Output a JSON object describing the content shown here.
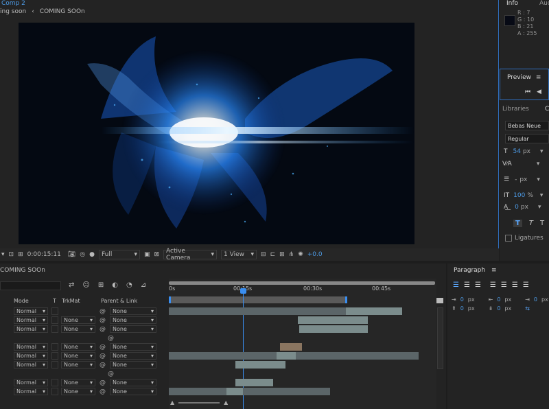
{
  "viewer": {
    "tab_comp": "Comp 2",
    "breadcrumb_1": "ing soon",
    "breadcrumb_sep": "‹",
    "breadcrumb_2": "COMING SOOn",
    "timecode": "0:00:15:11",
    "resolution": "Full",
    "camera": "Active Camera",
    "view": "1 View",
    "exposure": "+0.0"
  },
  "info": {
    "tab_info": "Info",
    "tab_audio": "Aud",
    "r": "R : 7",
    "g": "G : 10",
    "b": "B : 21",
    "a": "A : 255",
    "swatch_color": "#070a15"
  },
  "preview": {
    "title": "Preview",
    "menu": "≡"
  },
  "character": {
    "libraries": "Libraries",
    "font": "Bebas Neue",
    "style": "Regular",
    "size": "54",
    "size_unit": "px",
    "leading_value": "-",
    "leading_unit": "px",
    "vscale": "100",
    "vscale_unit": "%",
    "baseline": "0",
    "baseline_unit": "px",
    "ligatures": "Ligatures"
  },
  "timeline": {
    "comp_name": "COMING SOOn",
    "ruler": [
      "0s",
      "00:15s",
      "00:30s",
      "00:45s"
    ],
    "headers": {
      "mode": "Mode",
      "t": "T",
      "trkmat": "TrkMat",
      "parent": "Parent & Link"
    },
    "rows": [
      {
        "mode": "Normal",
        "trkmat": "",
        "parent": "None"
      },
      {
        "mode": "Normal",
        "trkmat": "None",
        "parent": "None"
      },
      {
        "mode": "Normal",
        "trkmat": "None",
        "parent": "None"
      },
      {
        "mode": "",
        "trkmat": "",
        "parent": ""
      },
      {
        "mode": "Normal",
        "trkmat": "None",
        "parent": "None"
      },
      {
        "mode": "Normal",
        "trkmat": "None",
        "parent": "None"
      },
      {
        "mode": "Normal",
        "trkmat": "None",
        "parent": "None"
      },
      {
        "mode": "",
        "trkmat": "",
        "parent": ""
      },
      {
        "mode": "Normal",
        "trkmat": "None",
        "parent": "None"
      },
      {
        "mode": "Normal",
        "trkmat": "None",
        "parent": "None"
      }
    ]
  },
  "paragraph": {
    "title": "Paragraph",
    "menu": "≡",
    "indent_left": "0",
    "indent_right": "0",
    "indent_first": "0",
    "space_before": "0",
    "space_after": "0",
    "unit": "px"
  }
}
